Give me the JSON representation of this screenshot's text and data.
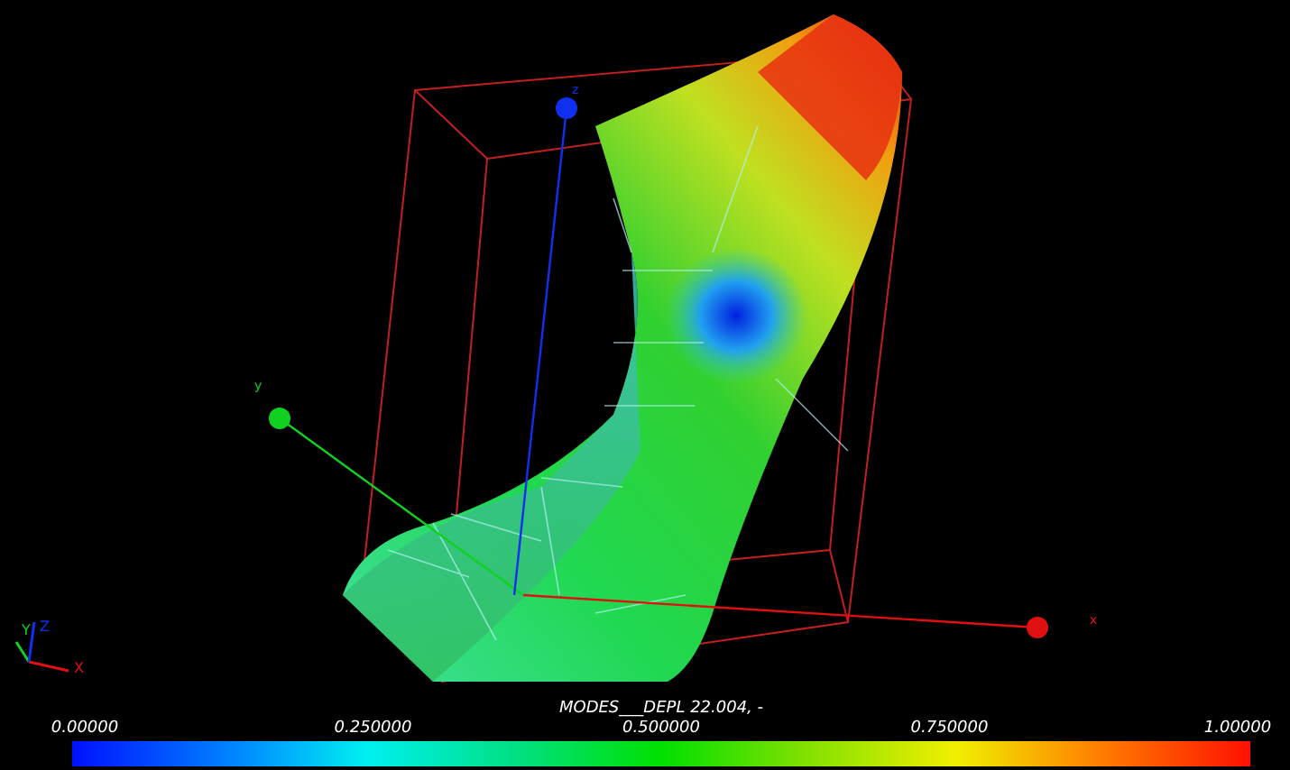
{
  "scene": {
    "axes": [
      {
        "label": "x",
        "color": "#e01010"
      },
      {
        "label": "y",
        "color": "#10d020"
      },
      {
        "label": "z",
        "color": "#1030f0"
      }
    ]
  },
  "triad": [
    {
      "label": "X",
      "color": "#e01010"
    },
    {
      "label": "Y",
      "color": "#10d020"
    },
    {
      "label": "Z",
      "color": "#1030f0"
    }
  ],
  "colorbar": {
    "title": "MODES___DEPL 22.004, -",
    "ticks": [
      "0.00000",
      "0.250000",
      "0.500000",
      "0.750000",
      "1.00000"
    ]
  }
}
